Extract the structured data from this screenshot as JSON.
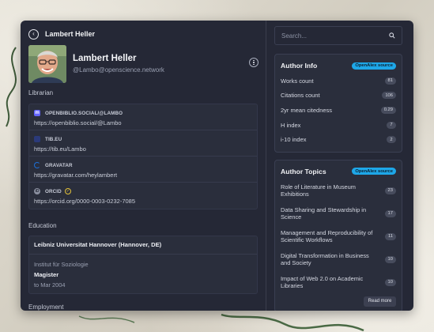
{
  "header": {
    "title": "Lambert Heller",
    "back_icon": "chevron-left-icon"
  },
  "profile": {
    "name": "Lambert Heller",
    "handle": "@Lambo@openscience.network",
    "role": "Librarian",
    "menu_icon": "more-vertical-icon"
  },
  "links": [
    {
      "label": "OPENBIBLIO.SOCIAL/@LAMBO",
      "url": "https://openbiblio.social/@Lambo",
      "icon": "mastodon-icon",
      "color": "#6364ff"
    },
    {
      "label": "TIB.EU",
      "url": "https://tib.eu/Lambo",
      "icon": "globe-icon",
      "color": "#2b3a7a"
    },
    {
      "label": "GRAVATAR",
      "url": "https://gravatar.com/heylambert",
      "icon": "gravatar-icon",
      "color": "#1d6fd6"
    },
    {
      "label": "ORCID",
      "url": "https://orcid.org/0000-0003-0232-7085",
      "icon": "orcid-icon",
      "color": "#a6ce39",
      "verified": true
    }
  ],
  "education": {
    "section_label": "Education",
    "institution": "Leibniz Universitat Hannover (Hannover, DE)",
    "department": "Institut für Soziologie",
    "degree": "Magister",
    "date": "to Mar 2004"
  },
  "employment": {
    "section_label": "Employment"
  },
  "search": {
    "placeholder": "Search..."
  },
  "author_info": {
    "title": "Author Info",
    "badge": "OpenAlex source",
    "rows": [
      {
        "label": "Works count",
        "value": "81"
      },
      {
        "label": "Citations count",
        "value": "106"
      },
      {
        "label": "2yr mean citedness",
        "value": "0.29"
      },
      {
        "label": "H index",
        "value": "7"
      },
      {
        "label": "i-10 index",
        "value": "2"
      }
    ]
  },
  "author_topics": {
    "title": "Author Topics",
    "badge": "OpenAlex source",
    "rows": [
      {
        "label": "Role of Literature in Museum Exhibitions",
        "value": "23"
      },
      {
        "label": "Data Sharing and Stewardship in Science",
        "value": "17"
      },
      {
        "label": "Management and Reproducibility of Scientific Workflows",
        "value": "11"
      },
      {
        "label": "Digital Transformation in Business and Society",
        "value": "10"
      },
      {
        "label": "Impact of Web 2.0 on Academic Libraries",
        "value": "10"
      }
    ],
    "read_more": "Read more"
  },
  "colors": {
    "panel": "#252836",
    "accent_badge": "#1ea7e8",
    "verified": "#e3c23a"
  }
}
